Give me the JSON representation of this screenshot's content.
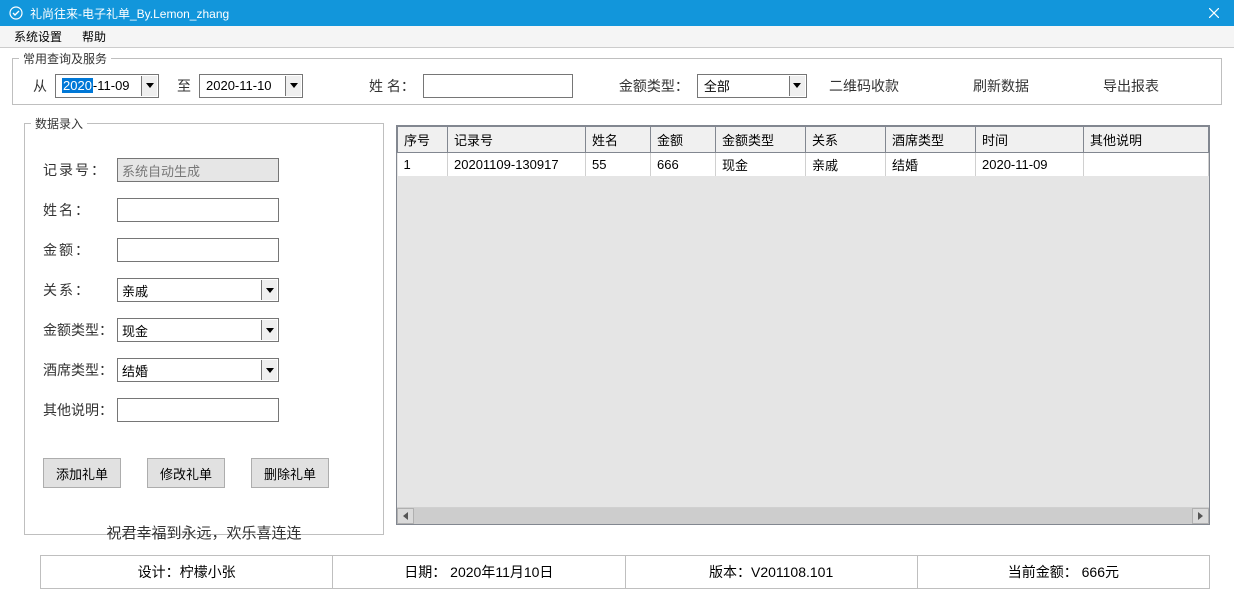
{
  "title": "礼尚往来-电子礼单_By.Lemon_zhang",
  "menu": {
    "system_settings": "系统设置",
    "help": "帮助"
  },
  "filter_group": {
    "legend": "常用查询及服务",
    "from_label": "从",
    "to_label": "至",
    "date_from_year": "2020",
    "date_from_rest": "-11-09",
    "date_to": "2020-11-10",
    "name_label": "姓 名：",
    "name_value": "",
    "amount_type_label": "金额类型：",
    "amount_type_value": "全部",
    "qr_collect": "二维码收款",
    "refresh": "刷新数据",
    "export": "导出报表"
  },
  "entry_group": {
    "legend": "数据录入",
    "record_no_label": "记录号：",
    "record_no_value": "系统自动生成",
    "name_label": "姓名：",
    "name_value": "",
    "amount_label": "金额：",
    "amount_value": "",
    "relation_label": "关系：",
    "relation_value": "亲戚",
    "amount_type_label": "金额类型：",
    "amount_type_value": "现金",
    "banquet_type_label": "酒席类型：",
    "banquet_type_value": "结婚",
    "other_desc_label": "其他说明：",
    "other_desc_value": "",
    "add_btn": "添加礼单",
    "edit_btn": "修改礼单",
    "delete_btn": "删除礼单",
    "blessing": "祝君幸福到永远，欢乐喜连连"
  },
  "grid": {
    "headers": {
      "seq": "序号",
      "record_no": "记录号",
      "name": "姓名",
      "amount": "金额",
      "amount_type": "金额类型",
      "relation": "关系",
      "banquet_type": "酒席类型",
      "time": "时间",
      "other": "其他说明"
    },
    "rows": [
      {
        "seq": "1",
        "record_no": "20201109-130917",
        "name": "55",
        "amount": "666",
        "amount_type": "现金",
        "relation": "亲戚",
        "banquet_type": "结婚",
        "time": "2020-11-09",
        "other": ""
      }
    ]
  },
  "status": {
    "designer": "设计：柠檬小张",
    "date": "日期：  2020年11月10日",
    "version": "版本：V201108.101",
    "current_amount": "当前金额：  666元"
  }
}
